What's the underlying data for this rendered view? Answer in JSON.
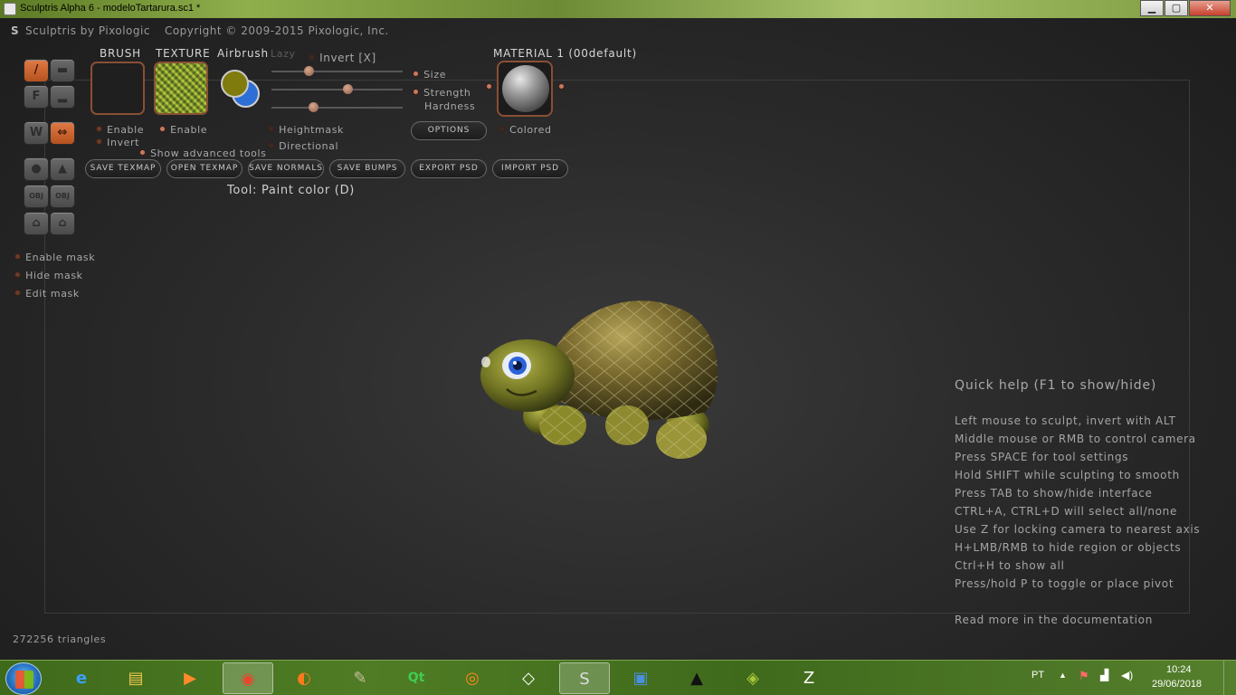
{
  "window": {
    "title": "Sculptris Alpha 6 - modeloTartarura.sc1 *",
    "minimize": "▁",
    "maximize": "▢",
    "close": "✕"
  },
  "header": {
    "brand": "Sculptris by Pixologic",
    "copyright": "Copyright © 2009-2015 Pixologic, Inc."
  },
  "left_tools": {
    "buttons": [
      "paint-brush",
      "flatten",
      "F",
      "smooth",
      "grab-waves",
      "symmetry",
      "sphere",
      "plane",
      "OBJ",
      "OBJ",
      "import",
      "export"
    ],
    "mask_options": [
      "Enable mask",
      "Hide mask",
      "Edit mask"
    ]
  },
  "brush": {
    "header": "BRUSH",
    "enable": "Enable",
    "invert": "Invert"
  },
  "texture": {
    "header": "TEXTURE",
    "enable": "Enable"
  },
  "airbrush": {
    "header": "Airbrush",
    "primary_color": "#7f7b0c",
    "secondary_color": "#2d6fd6"
  },
  "controls": {
    "lazy": "Lazy",
    "invert": "Invert [X]",
    "size": "Size",
    "strength": "Strength",
    "hardness": "Hardness",
    "heightmask": "Heightmask",
    "directional": "Directional",
    "show_advanced": "Show advanced tools",
    "options": "OPTIONS"
  },
  "material": {
    "header": "MATERIAL 1 (00default)",
    "colored": "Colored"
  },
  "actions": [
    "SAVE TEXMAP",
    "OPEN TEXMAP",
    "SAVE NORMALS",
    "SAVE BUMPS",
    "EXPORT PSD",
    "IMPORT PSD"
  ],
  "tool_status": "Tool: Paint color (D)",
  "quick_help": {
    "title": "Quick help (F1 to show/hide)",
    "lines": [
      "Left mouse to sculpt, invert with ALT",
      "Middle mouse or RMB to control camera",
      "Press SPACE for tool settings",
      "Hold SHIFT while sculpting to smooth",
      "Press TAB to show/hide interface",
      "CTRL+A, CTRL+D will select all/none",
      "Use Z for locking camera to nearest axis",
      "H+LMB/RMB to hide region or objects",
      "Ctrl+H to show all",
      "Press/hold P to toggle or place pivot"
    ],
    "docs_link": "Read more in the documentation"
  },
  "triangles": "272256 triangles",
  "taskbar": {
    "apps": [
      "internet-explorer",
      "file-explorer",
      "media-player",
      "chrome",
      "firefox",
      "gimp",
      "qt",
      "blender",
      "unity",
      "sculptris",
      "photo-app",
      "inkscape",
      "android-studio",
      "zbrush"
    ],
    "language": "PT",
    "time": "10:24",
    "date": "29/06/2018"
  }
}
